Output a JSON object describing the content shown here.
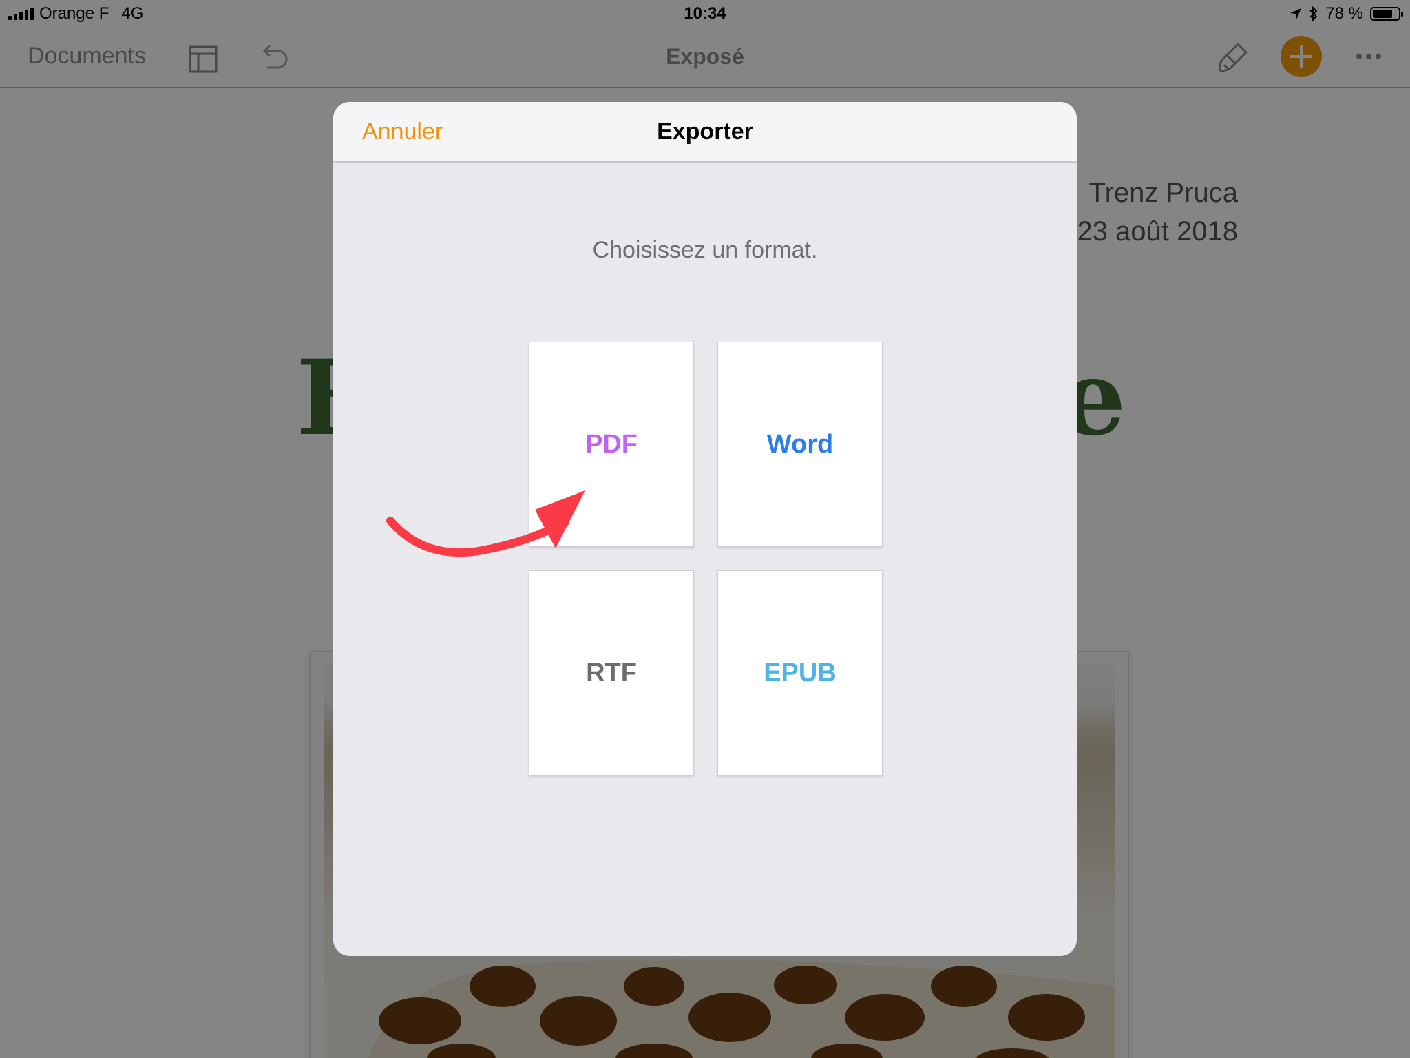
{
  "status_bar": {
    "carrier": "Orange F",
    "network": "4G",
    "time": "10:34",
    "battery_text": "78 %",
    "battery_level": 0.78
  },
  "toolbar": {
    "documents_label": "Documents",
    "title": "Exposé",
    "add_button_color": "#f29c0e"
  },
  "document": {
    "author": "Trenz Pruca",
    "date": "23 août 2018",
    "heading_start": "E",
    "heading_end": "e"
  },
  "dialog": {
    "cancel_label": "Annuler",
    "title": "Exporter",
    "prompt": "Choisissez un format.",
    "formats": [
      {
        "label": "PDF",
        "color": "#c064f0"
      },
      {
        "label": "Word",
        "color": "#2a7fe8"
      },
      {
        "label": "RTF",
        "color": "#6c6c6c"
      },
      {
        "label": "EPUB",
        "color": "#4fb3e6"
      }
    ]
  },
  "annotation": {
    "arrow_color": "#fa3a46",
    "arrow_target": "PDF"
  }
}
